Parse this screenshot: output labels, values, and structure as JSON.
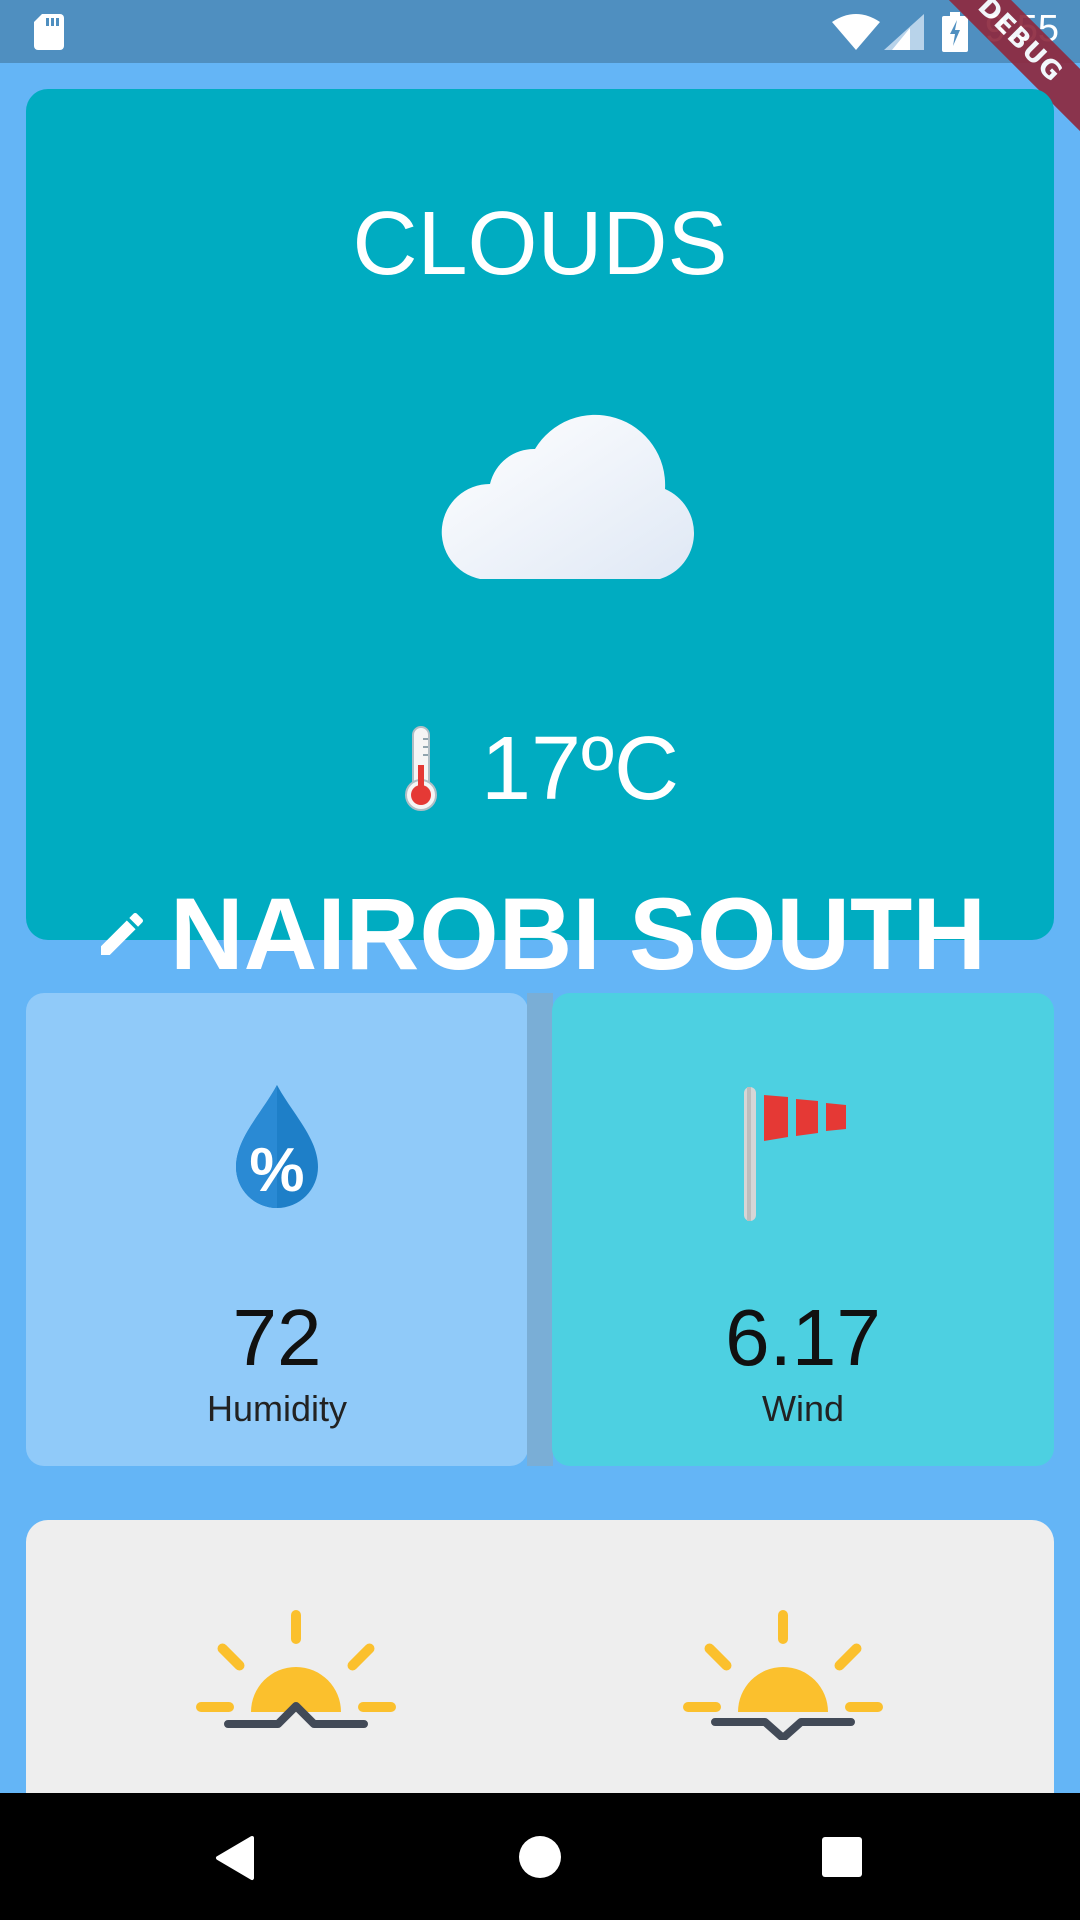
{
  "status_bar": {
    "time": "9:55",
    "debug_label": "DEBUG",
    "icons": [
      "sd-card-icon",
      "wifi-icon",
      "signal-icon",
      "battery-charging-icon"
    ]
  },
  "weather": {
    "condition": "CLOUDS",
    "temperature": "17ºC",
    "city": "NAIROBI SOUTH"
  },
  "stats": {
    "humidity": {
      "value": "72",
      "label": "Humidity"
    },
    "wind": {
      "value": "6.17",
      "label": "Wind"
    }
  },
  "sun": {
    "icons": [
      "sunrise-icon",
      "sunset-icon"
    ]
  },
  "colors": {
    "background": "#64b5f6",
    "main_card": "#00acc1",
    "humidity_card": "#90caf9",
    "wind_card": "#4dd0e1",
    "sun_card": "#eeeeee"
  }
}
